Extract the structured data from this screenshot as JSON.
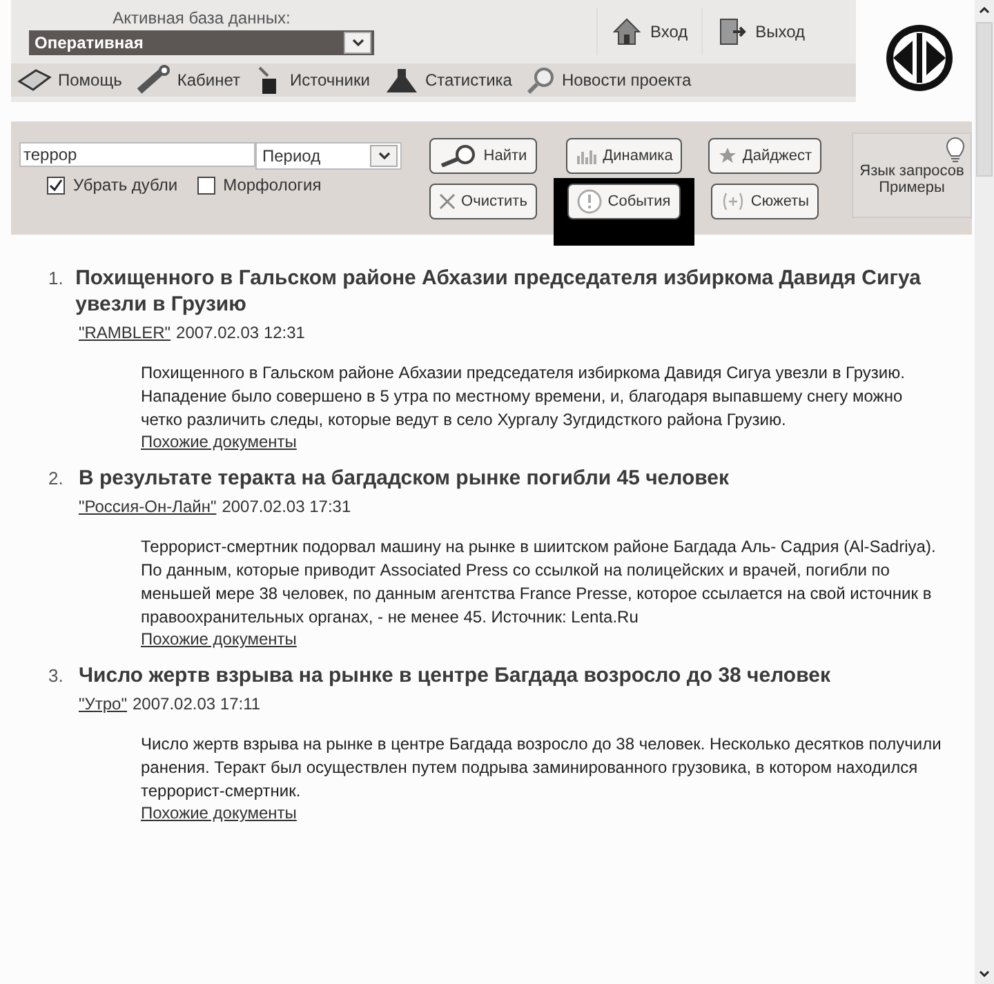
{
  "header": {
    "db_label": "Активная база данных:",
    "db_value": "Оперативная",
    "auth": [
      {
        "label": "Вход",
        "kind": "login"
      },
      {
        "label": "Выход",
        "kind": "logout"
      }
    ]
  },
  "nav": [
    {
      "label": "Помощь",
      "kind": "help"
    },
    {
      "label": "Кабинет",
      "kind": "tools"
    },
    {
      "label": "Источники",
      "kind": "sources"
    },
    {
      "label": "Статистика",
      "kind": "stats"
    },
    {
      "label": "Новости проекта",
      "kind": "news"
    }
  ],
  "search": {
    "value": "террор",
    "period": "Период",
    "options": [
      {
        "label": "Убрать дубли",
        "checked": true
      },
      {
        "label": "Морфология",
        "checked": false
      }
    ],
    "buttons": [
      {
        "label": "Найти",
        "kind": "find",
        "selected": false
      },
      {
        "label": "Динамика",
        "kind": "chart",
        "selected": false
      },
      {
        "label": "Дайджест",
        "kind": "star",
        "selected": false
      },
      {
        "label": "Очистить",
        "kind": "clear",
        "selected": false
      },
      {
        "label": "События",
        "kind": "alert",
        "selected": true
      },
      {
        "label": "Сюжеты",
        "kind": "plot",
        "selected": false
      }
    ],
    "help_lines": [
      "Язык запросов",
      "Примеры"
    ]
  },
  "results": [
    {
      "number": "1.",
      "title": "Похищенного в Гальском районе Абхазии председателя избиркома Давидя Сигуа увезли в Грузию",
      "source": "\"RAMBLER\"",
      "date": "2007.02.03 12:31",
      "text": "Похищенного в Гальском районе Абхазии председателя избиркома Давидя Сигуа увезли в Грузию. Нападение было совершено в 5 утра по местному времени, и, благодаря выпавшему снегу можно четко различить следы, которые ведут в село Хургалу Зугдидсткого района Грузию.",
      "similar": "Похожие документы"
    },
    {
      "number": "2.",
      "title": "В результате теракта на багдадском рынке погибли 45 человек",
      "source": "\"Россия-Он-Лайн\"",
      "date": "2007.02.03 17:31",
      "text": "Террорист-смертник подорвал машину на рынке в шиитском районе Багдада Аль- Садрия (Al-Sadriya). По данным, которые приводит Associated Press со ссылкой на полицейских и врачей, погибли по меньшей мере 38 человек, по данным агентства France Presse, которое ссылается на свой источник в правоохранительных органах, - не менее 45. Источник: Lenta.Ru",
      "similar": "Похожие документы"
    },
    {
      "number": "3.",
      "title": "Число жертв взрыва на рынке в центре Багдада возросло до 38 человек",
      "source": "\"Утро\"",
      "date": "2007.02.03 17:11",
      "text": "Число жертв взрыва на рынке в центре Багдада возросло до 38 человек. Несколько десятков получили ранения. Теракт был осуществлен путем подрыва заминированного грузовика, в котором находился террорист-смертник.",
      "similar": "Похожие документы"
    }
  ]
}
